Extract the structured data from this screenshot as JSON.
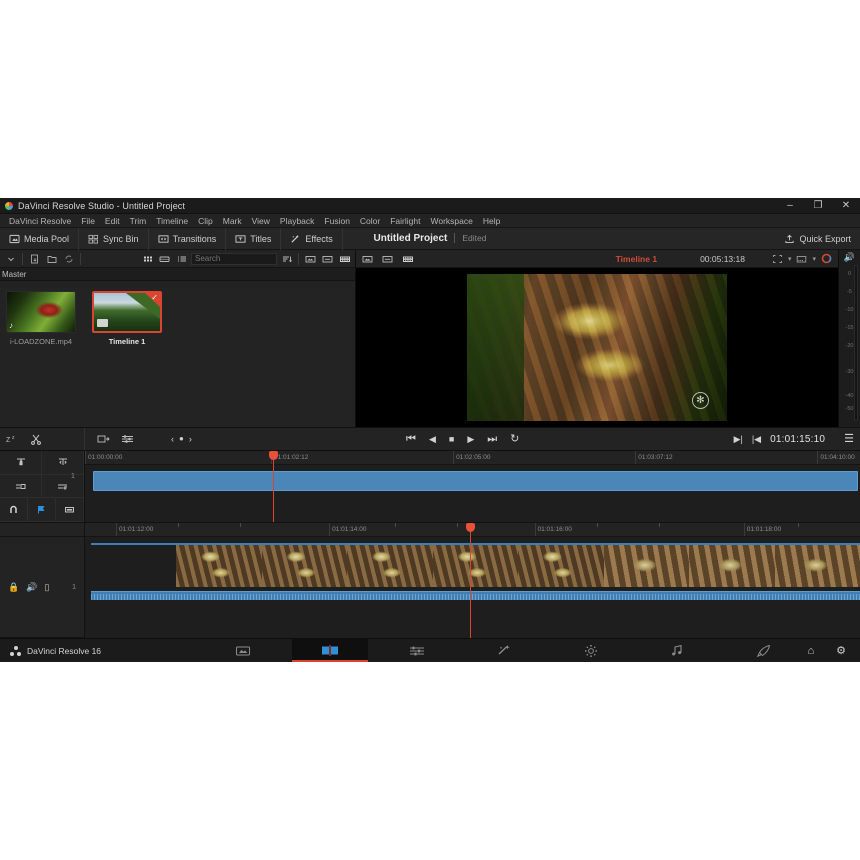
{
  "window": {
    "title": "DaVinci Resolve Studio - Untitled Project",
    "logo_icon": "resolve-logo-icon",
    "minimize_icon": "minimize-icon",
    "maximize_icon": "maximize-icon",
    "close_icon": "close-icon",
    "minimize_label": "–",
    "maximize_label": "❐",
    "close_label": "✕"
  },
  "menu": {
    "items": [
      "DaVinci Resolve",
      "File",
      "Edit",
      "Trim",
      "Timeline",
      "Clip",
      "Mark",
      "View",
      "Playback",
      "Fusion",
      "Color",
      "Fairlight",
      "Workspace",
      "Help"
    ]
  },
  "toolbar": {
    "buttons": [
      {
        "label": "Media Pool",
        "icon": "media-pool-icon"
      },
      {
        "label": "Sync Bin",
        "icon": "sync-bin-icon"
      },
      {
        "label": "Transitions",
        "icon": "transitions-icon"
      },
      {
        "label": "Titles",
        "icon": "titles-icon"
      },
      {
        "label": "Effects",
        "icon": "effects-icon"
      }
    ],
    "project_title": "Untitled Project",
    "project_status": "Edited",
    "quick_export_label": "Quick Export",
    "quick_export_icon": "upload-icon"
  },
  "media_pool": {
    "breadcrumb": "Master",
    "search_placeholder": "Search",
    "search_value": "",
    "icons": [
      "chevron-down-icon",
      "import-media-icon",
      "new-bin-icon",
      "sync-icon",
      "thumbnail-view-icon",
      "filmstrip-view-icon",
      "list-view-icon",
      "sort-icon",
      "metadata-icon",
      "clip-info-icon",
      "filmstrip-icon"
    ],
    "clips": [
      {
        "name": "i-LOADZONE.mp4",
        "type": "video",
        "selected": false,
        "badge": "audio-note-icon"
      },
      {
        "name": "Timeline 1",
        "type": "timeline",
        "selected": true,
        "badge": "timeline-icon"
      }
    ]
  },
  "viewer": {
    "header_icons": [
      "source-viewer-icon",
      "timeline-viewer-icon",
      "dual-viewer-icon"
    ],
    "timeline_name": "Timeline 1",
    "duration_timecode": "00:05:13:18",
    "enhanced_viewer_icon": "enhanced-viewer-icon",
    "viewer_options_icon": "viewer-options-icon",
    "color_wheel_icon": "color-wheel-icon",
    "transform_overlay_icon": "transform-handle-icon"
  },
  "audio_meter": {
    "speaker_icon": "speaker-icon",
    "scale": [
      "0",
      "-5",
      "-10",
      "-15",
      "-20",
      "-30",
      "-40",
      "-50"
    ]
  },
  "transport": {
    "left_icons": [
      "insert-clip-icon",
      "mixer-icon"
    ],
    "marker_prev_label": "‹",
    "marker_icon": "marker-dot-icon",
    "marker_next_label": "›",
    "controls": [
      {
        "icon": "jump-to-start-icon",
        "glyph": "⏮"
      },
      {
        "icon": "play-reverse-icon",
        "glyph": "◀"
      },
      {
        "icon": "stop-icon",
        "glyph": "■"
      },
      {
        "icon": "play-forward-icon",
        "glyph": "▶"
      },
      {
        "icon": "jump-to-end-icon",
        "glyph": "⏭"
      },
      {
        "icon": "loop-icon",
        "glyph": "↻"
      }
    ],
    "out_point_icon": "out-point-icon",
    "in_point_icon": "in-point-icon",
    "timecode": "01:01:15:10",
    "options_icon": "options-menu-icon"
  },
  "timeline_tools": {
    "top_icons": [
      "snooze-icon",
      "scissors-icon"
    ],
    "grid": [
      "trim-lock-icon",
      "flag-icon",
      "link-unlink-icon",
      "audio-link-icon"
    ],
    "bottom": [
      {
        "icon": "snap-magnet-icon",
        "active": false
      },
      {
        "icon": "flag-marker-icon",
        "active": true
      },
      {
        "icon": "position-lock-icon",
        "active": false
      }
    ]
  },
  "timeline_upper": {
    "ruler_labels": [
      "01:00:00:00",
      "01:01:02:12",
      "01:02:05:00",
      "01:03:07:12",
      "01:04:10:00"
    ],
    "track_number": "1",
    "playhead_percent": 24
  },
  "timeline_lower": {
    "ruler_labels": [
      "01:01:12:00",
      "01:01:14:00",
      "01:01:16:00",
      "01:01:18:00"
    ],
    "track_number": "1",
    "playhead_percent": 49.7,
    "track_header_icons": [
      "lock-icon",
      "audio-mute-icon",
      "video-monitor-icon"
    ]
  },
  "page_bar": {
    "brand": "DaVinci Resolve 16",
    "brand_icon": "resolve-dots-icon",
    "pages": [
      {
        "name": "media-page",
        "icon": "media-page-icon",
        "glyph": "⬚",
        "active": false
      },
      {
        "name": "cut-page",
        "icon": "cut-page-icon",
        "glyph": "◨",
        "active": true
      },
      {
        "name": "edit-page",
        "icon": "edit-page-icon",
        "glyph": "≡",
        "active": false
      },
      {
        "name": "fusion-page",
        "icon": "fusion-page-icon",
        "glyph": "✦",
        "active": false
      },
      {
        "name": "color-page",
        "icon": "color-page-icon",
        "glyph": "☀",
        "active": false
      },
      {
        "name": "fairlight-page",
        "icon": "fairlight-page-icon",
        "glyph": "♫",
        "active": false
      },
      {
        "name": "deliver-page",
        "icon": "deliver-page-icon",
        "glyph": "✈",
        "active": false
      }
    ],
    "right_icons": [
      {
        "name": "home-icon",
        "glyph": "⌂"
      },
      {
        "name": "settings-gear-icon",
        "glyph": "⚙"
      }
    ]
  }
}
